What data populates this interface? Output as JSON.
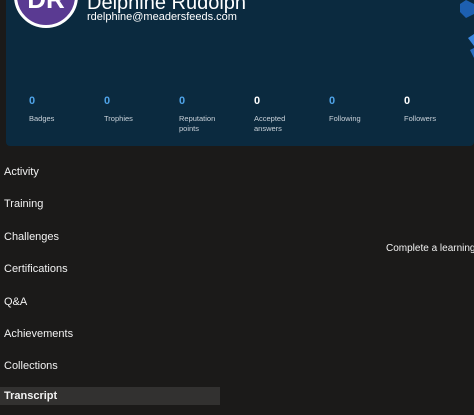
{
  "profile": {
    "initials": "DR",
    "name": "Delphine Rudolph",
    "email": "rdelphine@meadersfeeds.com"
  },
  "stats": [
    {
      "value": "0",
      "label": "Badges"
    },
    {
      "value": "0",
      "label": "Trophies"
    },
    {
      "value": "0",
      "label": "Reputation points"
    },
    {
      "value": "0",
      "label": "Accepted answers"
    },
    {
      "value": "0",
      "label": "Following"
    },
    {
      "value": "0",
      "label": "Followers"
    }
  ],
  "nav": {
    "items": [
      {
        "label": "Activity"
      },
      {
        "label": "Training"
      },
      {
        "label": "Challenges"
      },
      {
        "label": "Certifications"
      },
      {
        "label": "Q&A"
      },
      {
        "label": "Achievements"
      },
      {
        "label": "Collections"
      },
      {
        "label": "Transcript",
        "active": true
      }
    ]
  },
  "side_text": "Complete a learning",
  "colors": {
    "card_bg": "#0b2a3f",
    "avatar_bg": "#5a3a92",
    "stat_blue": "#4fa3e8",
    "page_bg": "#1b1a19",
    "active_bg": "#323130"
  }
}
